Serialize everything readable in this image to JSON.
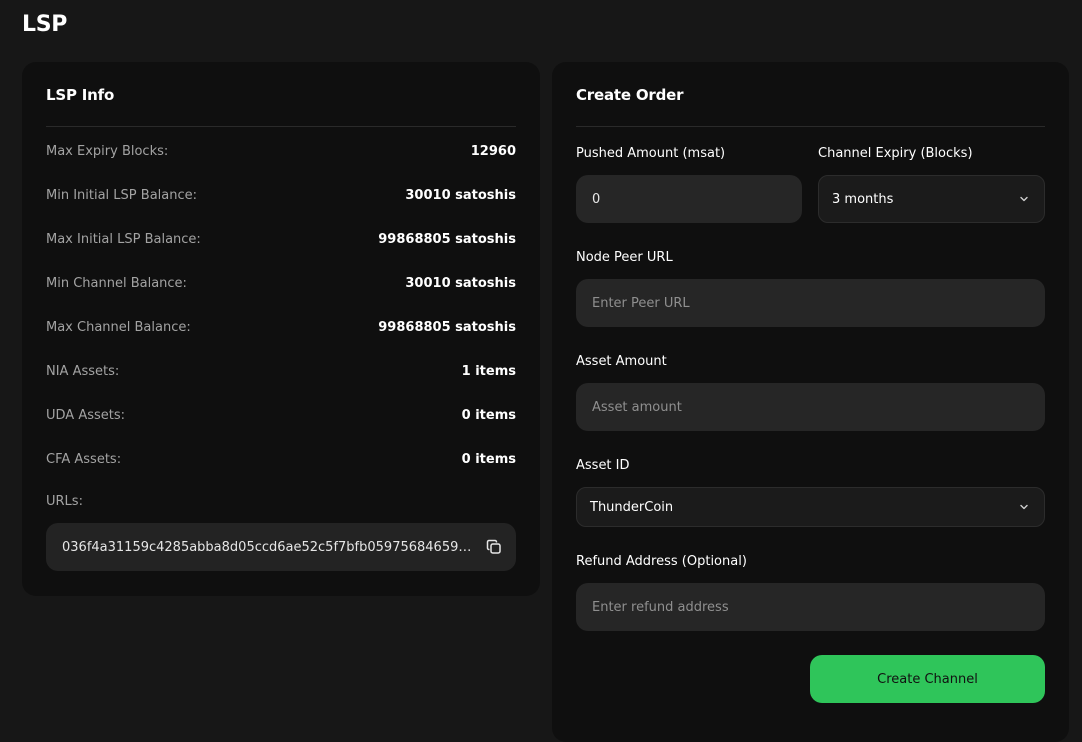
{
  "page": {
    "title": "LSP"
  },
  "lsp_info": {
    "title": "LSP Info",
    "rows": [
      {
        "label": "Max Expiry Blocks:",
        "value": "12960"
      },
      {
        "label": "Min Initial LSP Balance:",
        "value": "30010 satoshis"
      },
      {
        "label": "Max Initial LSP Balance:",
        "value": "99868805 satoshis"
      },
      {
        "label": "Min Channel Balance:",
        "value": "30010 satoshis"
      },
      {
        "label": "Max Channel Balance:",
        "value": "99868805 satoshis"
      },
      {
        "label": "NIA Assets:",
        "value": "1 items"
      },
      {
        "label": "UDA Assets:",
        "value": "0 items"
      },
      {
        "label": "CFA Assets:",
        "value": "0 items"
      }
    ],
    "urls_label": "URLs:",
    "url": "036f4a31159c4285abba8d05ccd6ae52c5f7bfb05975684659f9..."
  },
  "create_order": {
    "title": "Create Order",
    "pushed_amount": {
      "label": "Pushed Amount (msat)",
      "value": "0"
    },
    "channel_expiry": {
      "label": "Channel Expiry (Blocks)",
      "selected": "3 months"
    },
    "node_peer_url": {
      "label": "Node Peer URL",
      "placeholder": "Enter Peer URL"
    },
    "asset_amount": {
      "label": "Asset Amount",
      "placeholder": "Asset amount"
    },
    "asset_id": {
      "label": "Asset ID",
      "selected": "ThunderCoin"
    },
    "refund_address": {
      "label": "Refund Address (Optional)",
      "placeholder": "Enter refund address"
    },
    "submit_label": "Create Channel"
  },
  "colors": {
    "background": "#171717",
    "card": "#0f0f0f",
    "input": "#262626",
    "accent": "#2fc55a"
  }
}
